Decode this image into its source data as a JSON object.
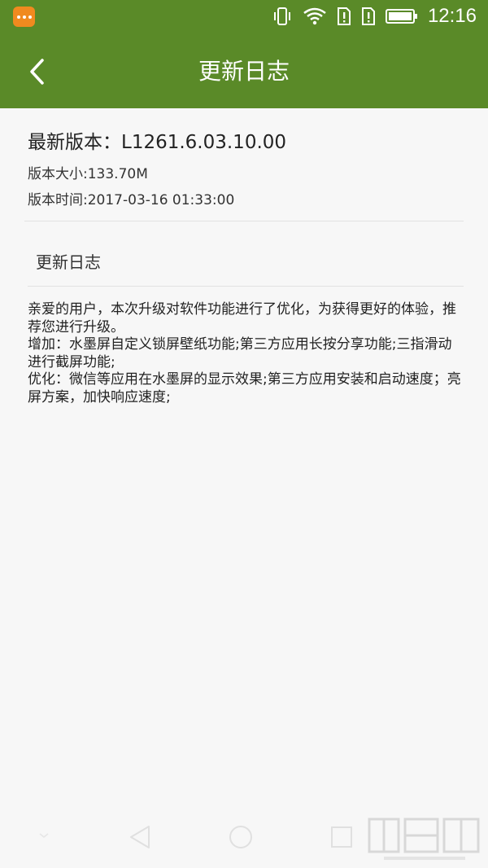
{
  "status_bar": {
    "time": "12:16",
    "icons": [
      "notification-app-icon",
      "vibrate-icon",
      "wifi-icon",
      "sim-alert-icon",
      "sim-alert-icon",
      "battery-icon"
    ]
  },
  "toolbar": {
    "title": "更新日志",
    "back_icon": "chevron-left-icon"
  },
  "version": {
    "title": "最新版本：L1261.6.03.10.00",
    "size": "版本大小:133.70M",
    "time": "版本时间:2017-03-16 01:33:00"
  },
  "changelog": {
    "heading": "更新日志",
    "lines": [
      "亲爱的用户，本次升级对软件功能进行了优化，为获得更好的体验，推荐您进行升级。",
      "增加：水墨屏自定义锁屏壁纸功能;第三方应用长按分享功能;三指滑动进行截屏功能;",
      "优化：微信等应用在水墨屏的显示效果;第三方应用安装和启动速度；亮屏方案，加快响应速度;"
    ]
  },
  "nav_bar": {
    "icons": [
      "collapse-icon",
      "back-triangle-icon",
      "home-circle-icon",
      "recents-square-icon"
    ]
  },
  "colors": {
    "header": "#5a8a28",
    "notification": "#f08a1f",
    "background": "#f7f7f7"
  }
}
